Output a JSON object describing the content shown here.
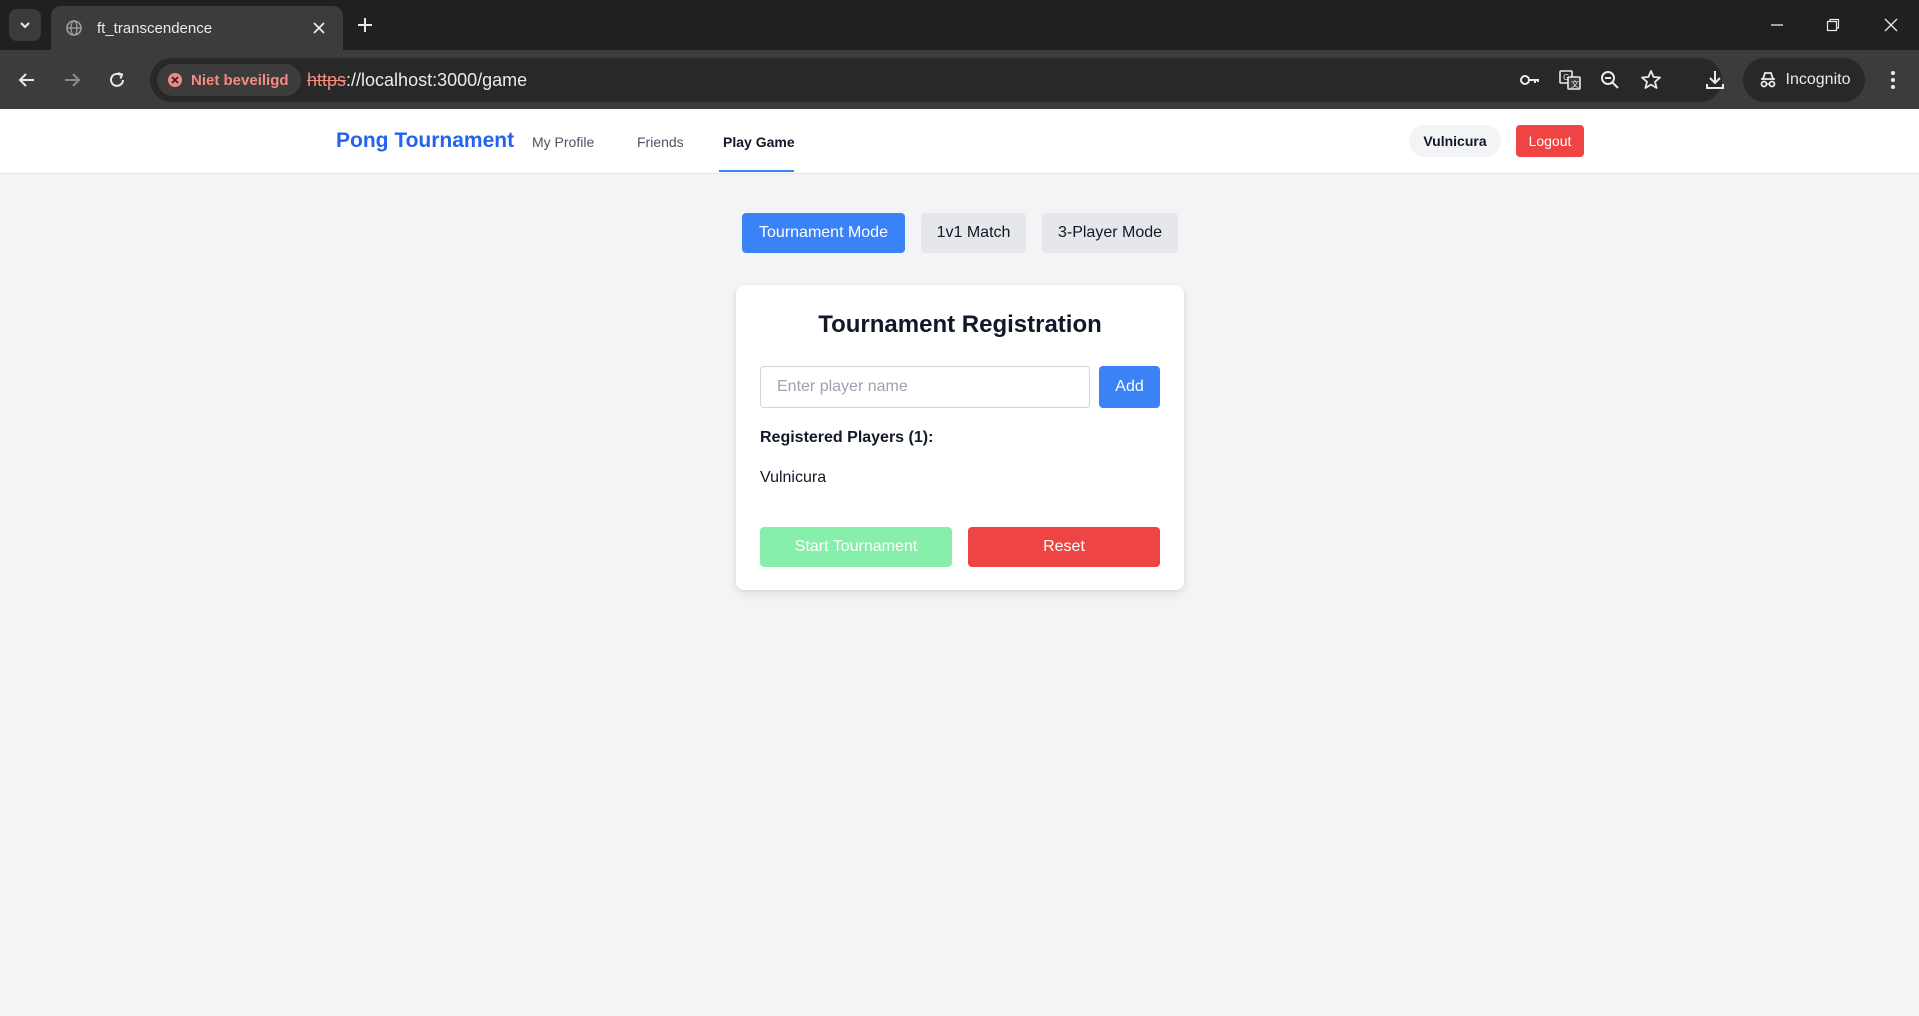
{
  "browser": {
    "tab": {
      "title": "ft_transcendence"
    },
    "security_label": "Niet beveiligd",
    "url": {
      "scheme": "https",
      "rest": "://localhost:3000/game"
    },
    "incognito_label": "Incognito",
    "icons": [
      "tab-list-icon",
      "globe-icon",
      "close-icon",
      "plus-icon",
      "minimize-icon",
      "restore-icon",
      "window-close-icon",
      "back-icon",
      "forward-icon",
      "reload-icon",
      "warning-icon",
      "key-icon",
      "translate-icon",
      "zoom-icon",
      "star-icon",
      "download-icon",
      "incognito-icon",
      "menu-icon"
    ]
  },
  "navbar": {
    "brand": "Pong Tournament",
    "links": [
      {
        "label": "My Profile",
        "active": false
      },
      {
        "label": "Friends",
        "active": false
      },
      {
        "label": "Play Game",
        "active": true
      }
    ],
    "user": "Vulnicura",
    "logout_label": "Logout"
  },
  "modes": [
    {
      "label": "Tournament Mode",
      "active": true
    },
    {
      "label": "1v1 Match",
      "active": false
    },
    {
      "label": "3-Player Mode",
      "active": false
    }
  ],
  "registration": {
    "title": "Tournament Registration",
    "input_placeholder": "Enter player name",
    "input_value": "",
    "add_label": "Add",
    "registered_heading": "Registered Players (1):",
    "players": [
      "Vulnicura"
    ],
    "start_label": "Start Tournament",
    "start_disabled": true,
    "reset_label": "Reset"
  },
  "colors": {
    "accent": "#3b82f6",
    "brand": "#2563eb",
    "danger": "#ef4444",
    "disabled_success": "#86efac",
    "chrome_bg": "#1f2020",
    "toolbar_bg": "#3c3c3c",
    "security_warning": "#f28b82"
  }
}
